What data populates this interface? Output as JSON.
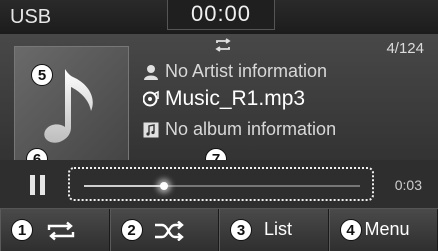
{
  "status_bar": {
    "source": "USB",
    "clock": "00:00"
  },
  "now_playing": {
    "track_counter": "4/124",
    "artist": "No Artist information",
    "title": "Music_R1.mp3",
    "album": "No album information",
    "repeat_icon": "repeat-icon"
  },
  "progress": {
    "elapsed": "0:03",
    "position_fraction": 0.29
  },
  "softkeys": [
    {
      "number": "1",
      "icon": "repeat-icon"
    },
    {
      "number": "2",
      "icon": "shuffle-icon"
    },
    {
      "number": "3",
      "label": "List"
    },
    {
      "number": "4",
      "label": "Menu"
    }
  ],
  "callouts": {
    "album_art": "5",
    "pause": "6",
    "progress_bar": "7"
  },
  "colors": {
    "background": "#3c3c3c",
    "text": "#d8d8d8",
    "highlight": "#ffffff"
  }
}
